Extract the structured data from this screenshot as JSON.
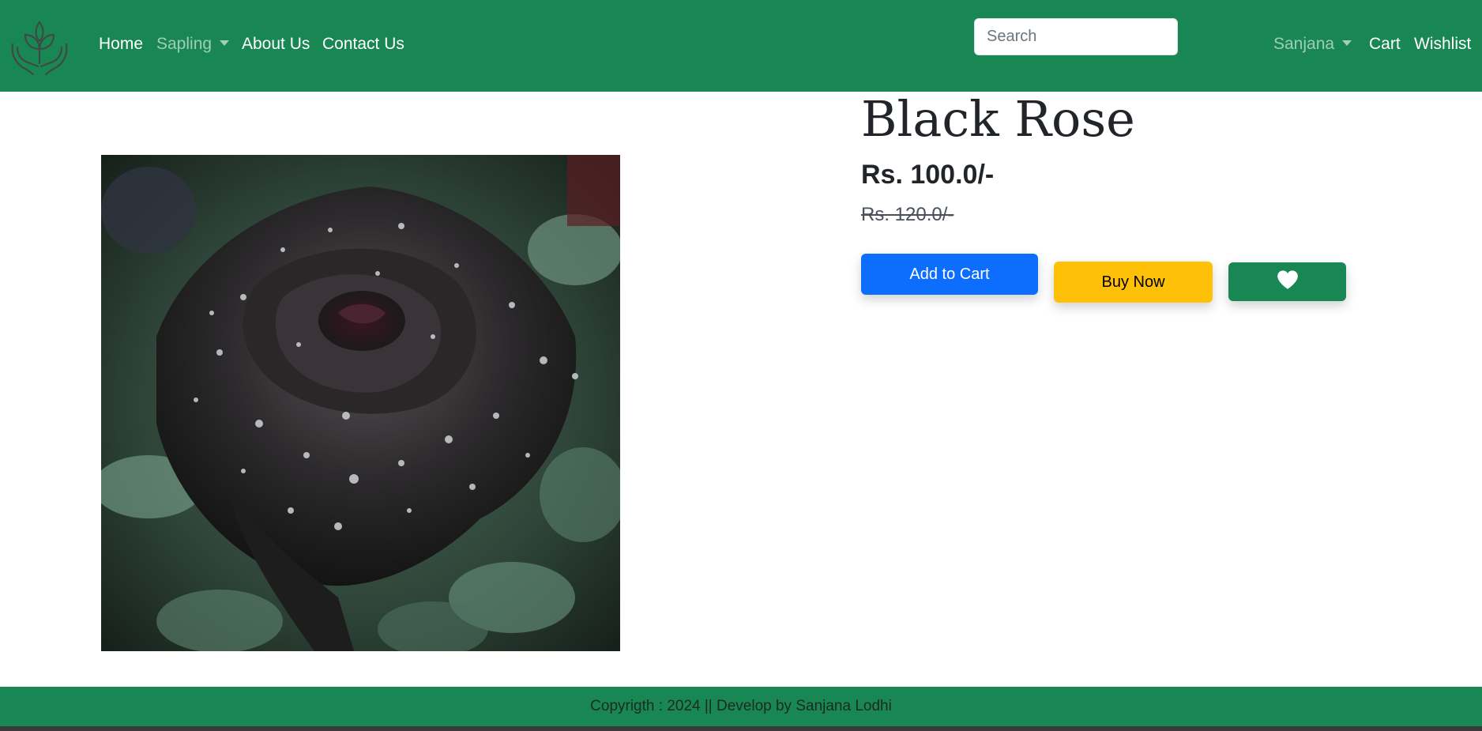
{
  "navbar": {
    "logo_icon": "plant-in-hands-icon",
    "links": {
      "home": "Home",
      "sapling": "Sapling",
      "about": "About Us",
      "contact": "Contact Us"
    },
    "search_placeholder": "Search",
    "user": "Sanjana",
    "cart": "Cart",
    "wishlist": "Wishlist"
  },
  "product": {
    "image_alt": "Black Rose",
    "title": "Black Rose",
    "price": "Rs. 100.0/-",
    "old_price": "Rs. 120.0/-",
    "add_to_cart_label": "Add to Cart",
    "buy_now_label": "Buy Now",
    "wishlist_icon": "heart-icon"
  },
  "footer": {
    "text": "Copyrigth : 2024 || Develop by Sanjana Lodhi"
  },
  "colors": {
    "navbar_bg": "#198754",
    "primary_button": "#0d6efd",
    "warning_button": "#ffc107",
    "success_button": "#198754"
  }
}
